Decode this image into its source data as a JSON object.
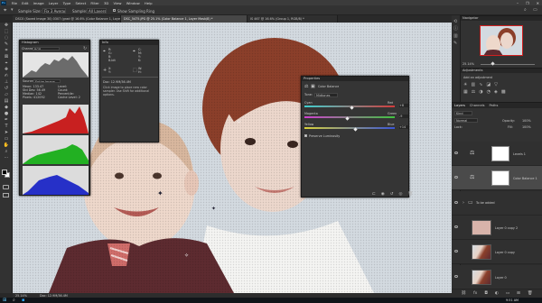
{
  "menubar": {
    "app_logo": "Ps",
    "items": [
      "File",
      "Edit",
      "Image",
      "Layer",
      "Type",
      "Select",
      "Filter",
      "3D",
      "View",
      "Window",
      "Help"
    ],
    "window_controls": [
      "–",
      "❐",
      "✕"
    ]
  },
  "options_bar": {
    "sample_size_label": "Fix 3 Average",
    "sample_label": "Sample:",
    "sample_value": "All Layers",
    "show_ring": "Show Sampling Ring"
  },
  "tabs": [
    "DSC0 (Saved Image 30) 0307 (grad @ 16.6% (Color Balance 1, Layer Mask/8) *",
    "DSC_5475.JPG @ 25.1% (Color Balance 1, Layer Mask/8) *",
    "IS 467 @ 16.6% (Group 1, RGB/8) *"
  ],
  "histogram": {
    "title": "Histogram",
    "channel_label": "Channel:",
    "channel_value": "RGB",
    "source_label": "Source:",
    "source_value": "Entire Image",
    "stats": [
      "Mean: 133.47",
      "Std Dev: 56.49",
      "Median: 142",
      "Pixels: 412092",
      "Level:",
      "Count:",
      "Percentile:",
      "Cache Level: 2"
    ]
  },
  "info": {
    "title": "Info",
    "readouts": [
      "R:",
      "G:",
      "B:",
      "8-bit",
      "C:",
      "M:",
      "Y:",
      "K:",
      "X:",
      "Y:",
      "W:",
      "H:"
    ],
    "doc_size": "Doc: 12.9M/36.4M",
    "hint": "Click image to place new color sampler. Use Shift for additional options."
  },
  "properties": {
    "title": "Properties",
    "panel_name": "Color Balance",
    "tone_label": "Tone:",
    "tone_value": "Midtones",
    "sliders": [
      {
        "left": "Cyan",
        "right": "Red",
        "value": "+8",
        "pos": 0.52,
        "gradient": [
          "#3fd0d0",
          "#d23b3b"
        ]
      },
      {
        "left": "Magenta",
        "right": "Green",
        "value": "-9",
        "pos": 0.47,
        "gradient": [
          "#d13fd1",
          "#3fc43f"
        ]
      },
      {
        "left": "Yellow",
        "right": "Blue",
        "value": "+14",
        "pos": 0.56,
        "gradient": [
          "#d8d23a",
          "#3a55d8"
        ]
      }
    ],
    "preserve_luminosity": "Preserve Luminosity"
  },
  "navigator": {
    "title": "Navigator",
    "zoom": "25.14%"
  },
  "adjustments": {
    "title": "Adjustments",
    "subtitle": "Add an adjustment"
  },
  "layers_panel": {
    "tabs": [
      "Layers",
      "Channels",
      "Paths"
    ],
    "kind_label": "Kind",
    "blend_mode": "Normal",
    "opacity_label": "Opacity:",
    "opacity_value": "100%",
    "lock_label": "Lock:",
    "fill_label": "Fill:",
    "fill_value": "100%",
    "layers": [
      {
        "name": "Levels 1",
        "thumb": "mask",
        "selected": false
      },
      {
        "name": "Color Balance 1",
        "thumb": "mask",
        "selected": true
      },
      {
        "name": "To be added",
        "thumb": "folder",
        "selected": false
      },
      {
        "name": "Layer 0 copy 2",
        "thumb": "photo-pink",
        "selected": false
      },
      {
        "name": "Layer 0 copy",
        "thumb": "photo",
        "selected": false
      },
      {
        "name": "Layer 0",
        "thumb": "photo",
        "selected": false
      }
    ]
  },
  "status_bar": {
    "zoom": "25.14%",
    "doc": "Doc: 12.9M/36.4M"
  },
  "taskbar": {
    "time": "9:51 AM"
  },
  "colors": {
    "accent": "#31a8ff",
    "panel_bg": "#323232"
  }
}
